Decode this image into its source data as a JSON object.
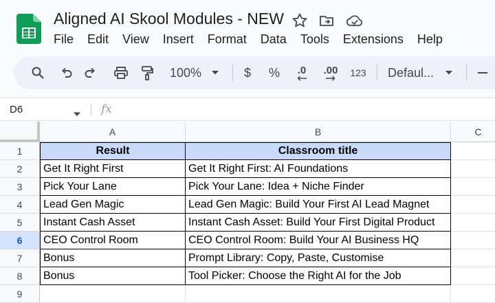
{
  "document": {
    "title": "Aligned AI Skool Modules - NEW"
  },
  "icons": {
    "star": "star-icon",
    "move": "folder-move-icon",
    "cloud": "cloud-done-icon",
    "app": "sheets-logo-icon"
  },
  "menu": [
    "File",
    "Edit",
    "View",
    "Insert",
    "Format",
    "Data",
    "Tools",
    "Extensions",
    "Help"
  ],
  "toolbar": {
    "zoom": "100%",
    "currency": "$",
    "percent": "%",
    "decrease_decimal": ".0",
    "increase_decimal": ".00",
    "number_format": "123",
    "font": "Defaul..."
  },
  "formula_bar": {
    "cell_ref": "D6",
    "fx": "fx",
    "value": ""
  },
  "grid": {
    "columns": [
      "A",
      "B",
      "C"
    ],
    "rows": [
      "1",
      "2",
      "3",
      "4",
      "5",
      "6",
      "7",
      "8",
      "9"
    ],
    "active_row": "6",
    "header_fill": "#c9daf8",
    "cells": [
      [
        "Result",
        "Classroom title"
      ],
      [
        "Get It Right First",
        "Get It Right First: AI Foundations"
      ],
      [
        "Pick Your Lane",
        "Pick Your Lane: Idea + Niche Finder"
      ],
      [
        "Lead Gen Magic",
        "Lead Gen Magic: Build Your First AI Lead Magnet"
      ],
      [
        "Instant Cash Asset",
        "Instant Cash Asset: Build Your First Digital Product"
      ],
      [
        "CEO Control Room",
        "CEO Control Room: Build Your AI Business HQ"
      ],
      [
        "Bonus",
        "Prompt Library: Copy, Paste, Customise"
      ],
      [
        "Bonus",
        "Tool Picker: Choose the Right AI for the Job"
      ]
    ]
  }
}
